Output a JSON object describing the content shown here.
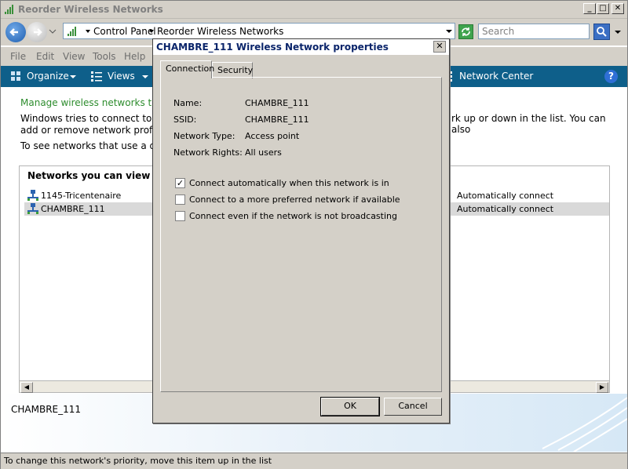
{
  "window": {
    "title": "Reorder Wireless Networks",
    "minimize_glyph": "_",
    "maximize_glyph": "□",
    "close_glyph": "✕"
  },
  "address": {
    "crumb1": "Control Panel",
    "crumb2": "Reorder Wireless Networks",
    "search_placeholder": "Search"
  },
  "menu": [
    "File",
    "Edit",
    "View",
    "Tools",
    "Help"
  ],
  "commands": {
    "organize": "Organize",
    "views": "Views",
    "network_center": "Network Center",
    "help_glyph": "?"
  },
  "content": {
    "manage_heading": "Manage wireless networks that u",
    "para1_line1": "Windows tries to connect to the",
    "para1_line2": "add or remove network profiles.",
    "para1_right": "rk up or down in the list. You can also",
    "para2": "To see networks that use a differ",
    "list_header": "Networks you can view and r",
    "networks": [
      {
        "name": "1145-Tricentenaire",
        "mode": "Automatically connect"
      },
      {
        "name": "CHAMBRE_111",
        "mode": "Automatically connect"
      }
    ]
  },
  "details": {
    "selected_name": "CHAMBRE_111"
  },
  "status": {
    "text": "To change this network's priority, move this item up in the list"
  },
  "dialog": {
    "title": "CHAMBRE_111 Wireless Network properties",
    "close_glyph": "✕",
    "tabs": [
      "Connection",
      "Security"
    ],
    "fields": [
      {
        "label": "Name:",
        "value": "CHAMBRE_111"
      },
      {
        "label": "SSID:",
        "value": "CHAMBRE_111"
      },
      {
        "label": "Network Type:",
        "value": "Access point"
      },
      {
        "label": "Network Rights:",
        "value": "All users"
      }
    ],
    "options": [
      {
        "label": "Connect automatically when this network is in",
        "checked": true
      },
      {
        "label": "Connect to a more preferred network if available",
        "checked": false
      },
      {
        "label": "Connect even if the network is not broadcasting",
        "checked": false
      }
    ],
    "check_glyph": "✓",
    "ok": "OK",
    "cancel": "Cancel"
  }
}
